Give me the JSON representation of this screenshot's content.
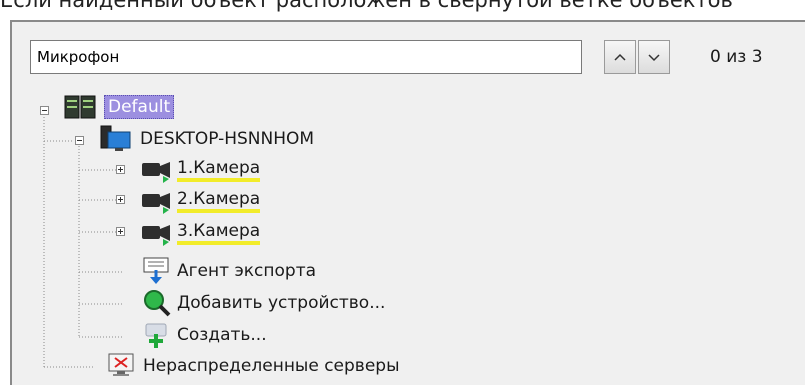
{
  "caption": "Если найденный объект расположен в свернутой ветке объектов",
  "search": {
    "value": "Микрофон",
    "counter": "0 из 3"
  },
  "tree": {
    "root": {
      "label": "Default",
      "icon": "server-rack-icon"
    },
    "computer": {
      "label": "DESKTOP-HSNNHOM",
      "icon": "computer-icon"
    },
    "cameras": [
      {
        "label": "1.Камера"
      },
      {
        "label": "2.Камера"
      },
      {
        "label": "3.Камера"
      }
    ],
    "export_agent": {
      "label": "Агент экспорта",
      "icon": "export-agent-icon"
    },
    "add_device": {
      "label": "Добавить устройство...",
      "icon": "magnifier-icon"
    },
    "create": {
      "label": "Создать...",
      "icon": "create-plus-icon"
    },
    "unassigned": {
      "label": "Нераспределенные серверы",
      "icon": "monitor-x-icon"
    }
  },
  "colors": {
    "selection": "#9c8fe0",
    "highlight": "#f2ec2a",
    "panel": "#f0f0f0"
  }
}
